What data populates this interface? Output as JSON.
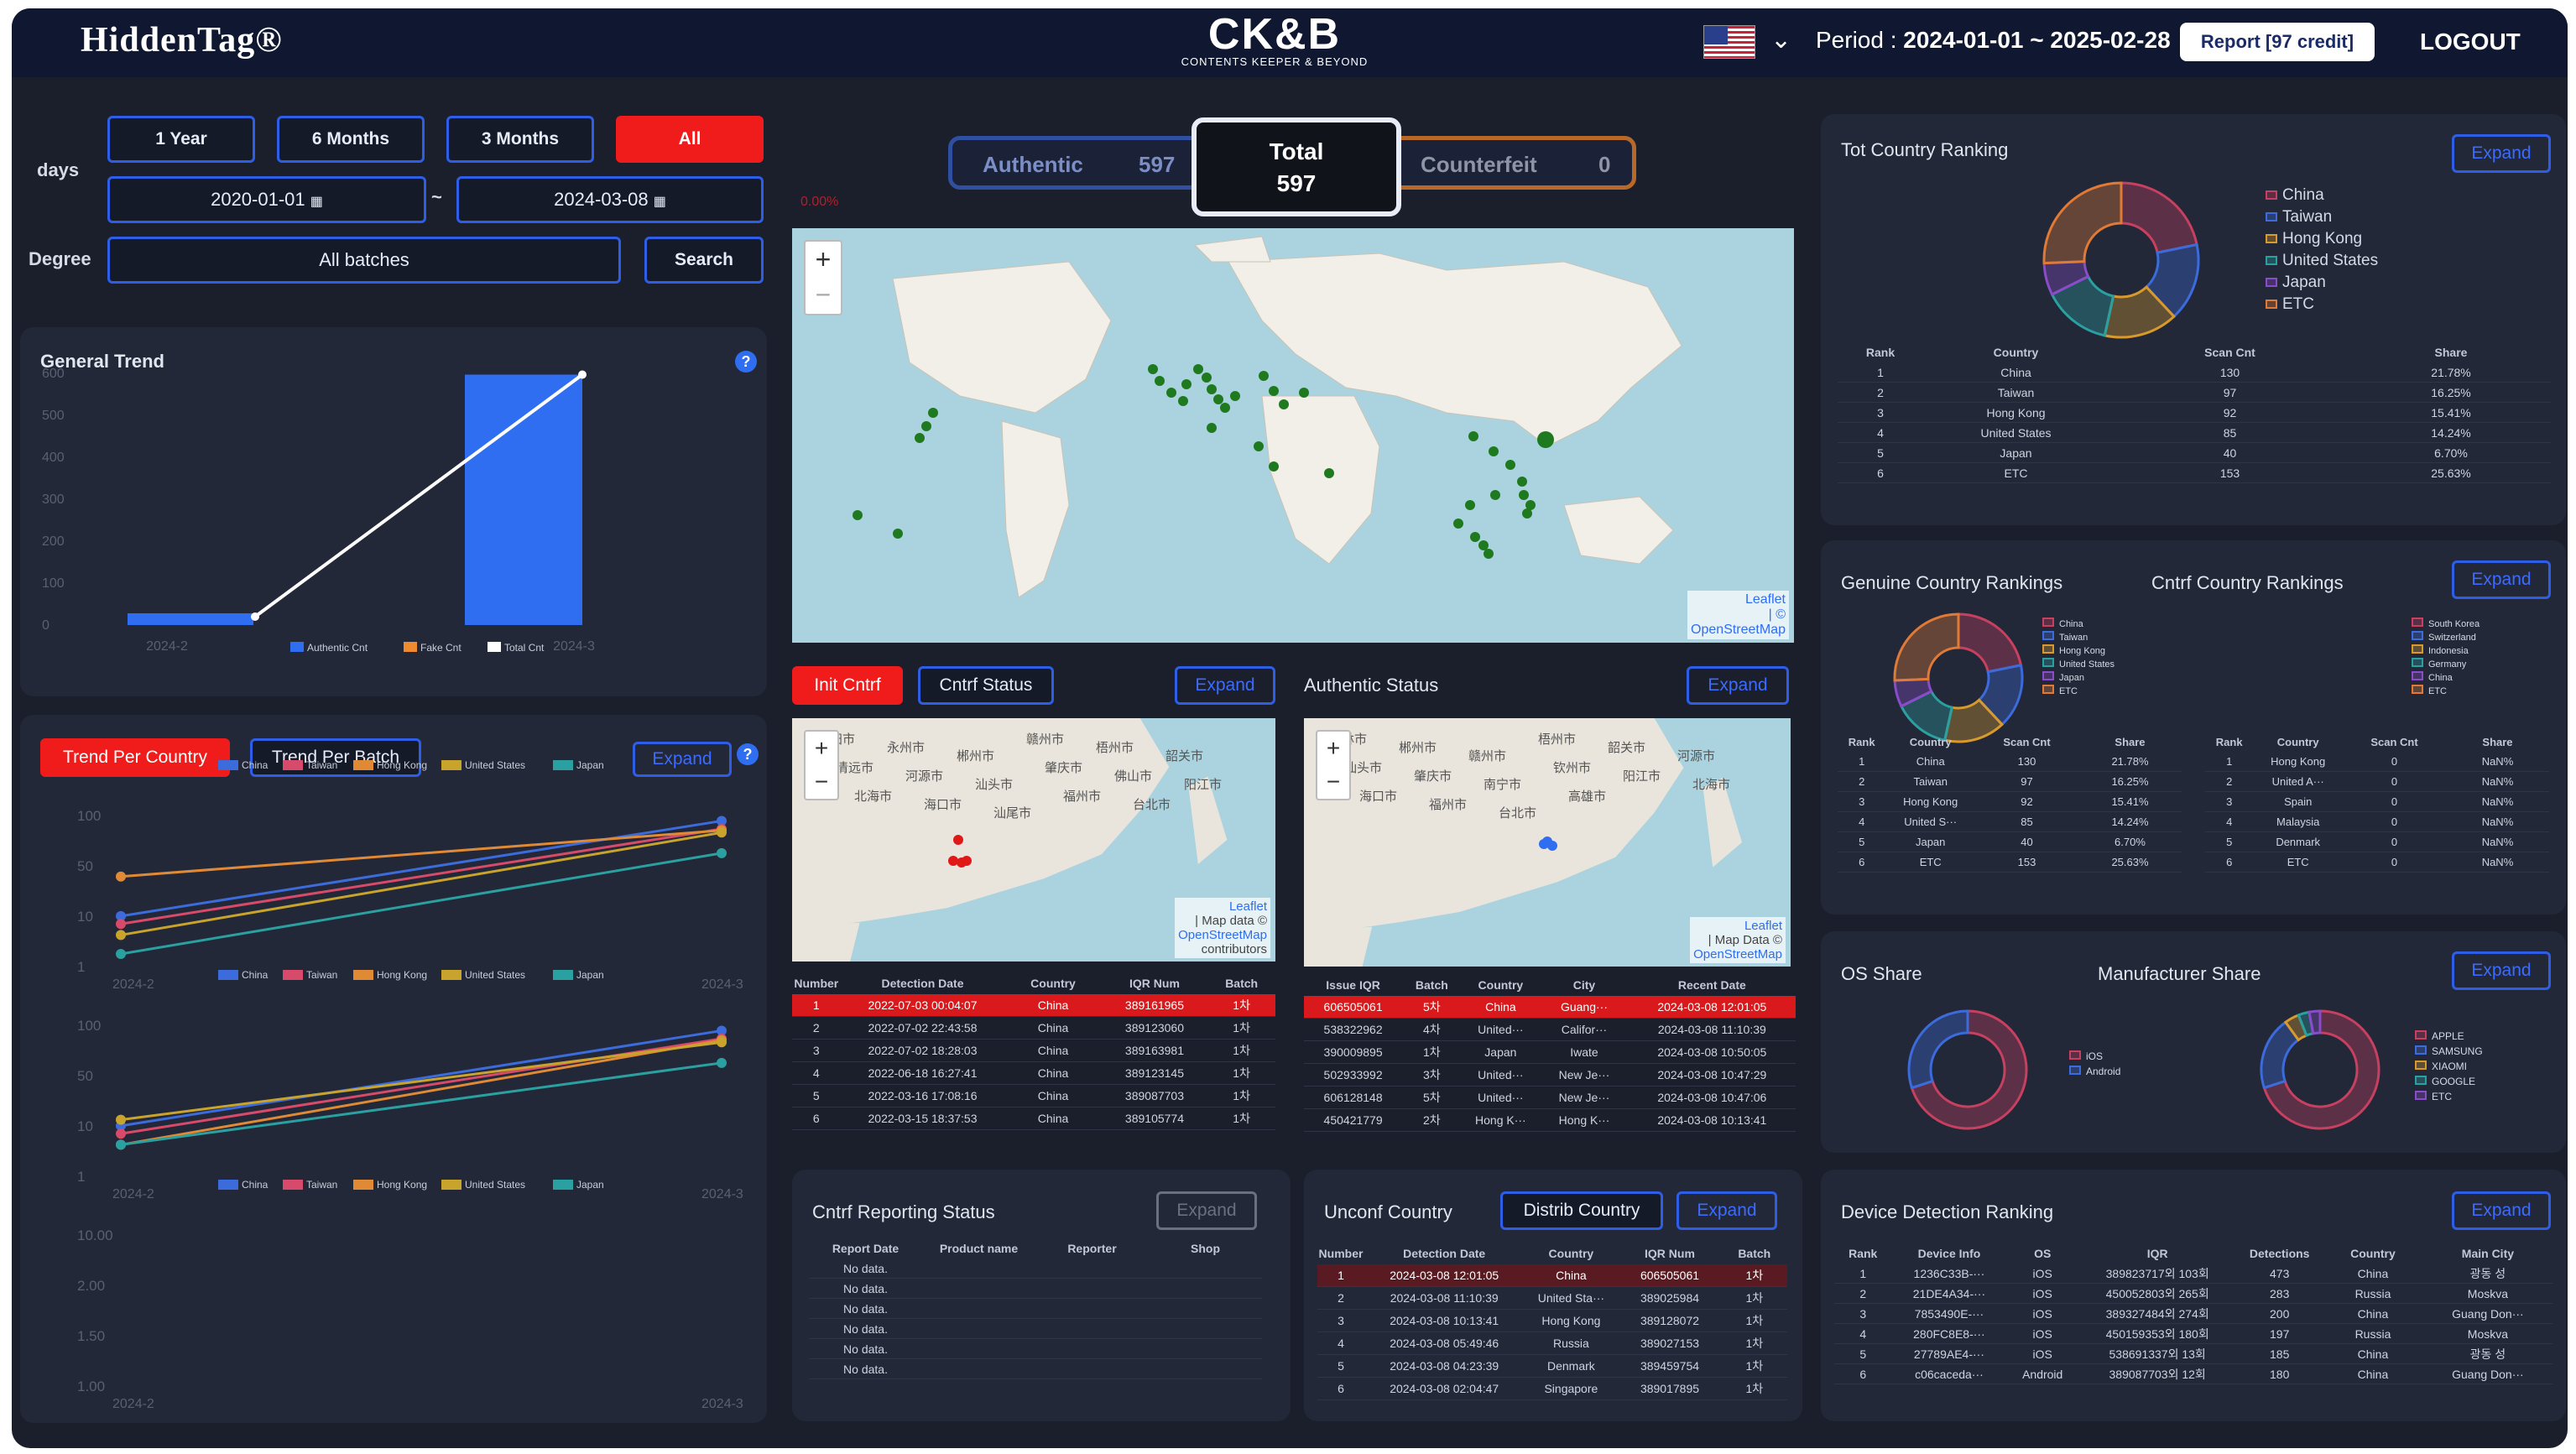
{
  "header": {
    "brand_left": "HiddenTag®",
    "brand_center": "CK&B",
    "brand_center_sub": "CONTENTS KEEPER & BEYOND",
    "period_label": "Period :",
    "period_value": "2024-01-01 ~ 2025-02-28",
    "report_button": "Report [97 credit]",
    "logout": "LOGOUT"
  },
  "filters": {
    "days_label": "days",
    "ranges": [
      "1 Year",
      "6 Months",
      "3 Months",
      "All"
    ],
    "active_range": "All",
    "date_from": "2020-01-01",
    "tilde": "~",
    "date_to": "2024-03-08",
    "degree_label": "Degree",
    "degree_value": "All batches",
    "search": "Search"
  },
  "general_trend": {
    "title": "General Trend",
    "help": "?",
    "chart_data": {
      "type": "bar",
      "categories": [
        "2024-2",
        "2024-3"
      ],
      "series": [
        {
          "name": "Authentic Cnt",
          "values": [
            20,
            597
          ],
          "color": "#2f6ef0"
        },
        {
          "name": "Fake Cnt",
          "values": [
            0,
            0
          ],
          "color": "#f08a2f"
        },
        {
          "name": "Total Cnt",
          "values": [
            20,
            597
          ],
          "color": "#ffffff"
        }
      ],
      "yticks": [
        "600",
        "500",
        "400",
        "300",
        "200",
        "100",
        "0"
      ],
      "ylim": [
        0,
        600
      ]
    }
  },
  "trend_country": {
    "tab_active": "Trend Per Country",
    "tab_other": "Trend Per Batch",
    "expand": "Expand",
    "help": "?",
    "legend": [
      {
        "name": "China",
        "color": "#3c6bdc"
      },
      {
        "name": "Taiwan",
        "color": "#d84a6a"
      },
      {
        "name": "Hong Kong",
        "color": "#e08a36"
      },
      {
        "name": "United States",
        "color": "#c9a42c"
      },
      {
        "name": "Japan",
        "color": "#2aa0a0"
      }
    ],
    "charts": [
      {
        "yticks": [
          "100",
          "50",
          "10",
          "1"
        ],
        "x": [
          "2024-2",
          "2024-3"
        ],
        "series": [
          {
            "name": "China",
            "values": [
              4,
              130
            ]
          },
          {
            "name": "Taiwan",
            "values": [
              3,
              97
            ]
          },
          {
            "name": "Hong Kong",
            "values": [
              17,
              92
            ]
          },
          {
            "name": "United States",
            "values": [
              2,
              85
            ]
          },
          {
            "name": "Japan",
            "values": [
              1,
              40
            ]
          }
        ]
      },
      {
        "yticks": [
          "100",
          "50",
          "10",
          "1"
        ],
        "x": [
          "2024-2",
          "2024-3"
        ],
        "series": [
          {
            "name": "China",
            "values": [
              4,
              130
            ]
          },
          {
            "name": "Taiwan",
            "values": [
              3,
              97
            ]
          },
          {
            "name": "Hong Kong",
            "values": [
              2,
              92
            ]
          },
          {
            "name": "United States",
            "values": [
              5,
              85
            ]
          },
          {
            "name": "Japan",
            "values": [
              2,
              40
            ]
          }
        ]
      },
      {
        "yticks": [
          "10.00",
          "2.00",
          "1.50",
          "1.00"
        ],
        "x": [
          "2024-2",
          "2024-3"
        ],
        "series": []
      }
    ]
  },
  "summary": {
    "authentic_label": "Authentic",
    "authentic_value": "597",
    "total_label": "Total",
    "total_value": "597",
    "counterfeit_label": "Counterfeit",
    "counterfeit_value": "0",
    "note": "0.00%"
  },
  "world_map": {
    "attribution_1": "Leaflet",
    "attribution_2": "| ©",
    "attribution_3": "OpenStreetMap"
  },
  "init_cntrf": {
    "tab_active": "Init Cntrf",
    "tab_other": "Cntrf Status",
    "expand": "Expand",
    "map_labels": [
      "衡阳市",
      "永州市",
      "郴州市",
      "赣州市",
      "梧州市",
      "韶关市",
      "清远市",
      "河源市",
      "汕头市",
      "肇庆市",
      "佛山市",
      "阳江市",
      "北海市",
      "海口市",
      "汕尾市",
      "福州市",
      "台北市"
    ],
    "map_attr": [
      "Leaflet",
      "| Map data ©",
      "OpenStreetMap",
      "contributors"
    ],
    "columns": [
      "Number",
      "Detection Date",
      "Country",
      "IQR Num",
      "Batch"
    ],
    "rows": [
      [
        "1",
        "2022-07-03 00:04:07",
        "China",
        "389161965",
        "1차"
      ],
      [
        "2",
        "2022-07-02 22:43:58",
        "China",
        "389123060",
        "1차"
      ],
      [
        "3",
        "2022-07-02 18:28:03",
        "China",
        "389163981",
        "1차"
      ],
      [
        "4",
        "2022-06-18 16:27:41",
        "China",
        "389123145",
        "1차"
      ],
      [
        "5",
        "2022-03-16 17:08:16",
        "China",
        "389087703",
        "1차"
      ],
      [
        "6",
        "2022-03-15 18:37:53",
        "China",
        "389105774",
        "1차"
      ]
    ]
  },
  "authentic_status": {
    "title": "Authentic Status",
    "expand": "Expand",
    "map_labels": [
      "桂林市",
      "郴州市",
      "赣州市",
      "梧州市",
      "韶关市",
      "河源市",
      "汕头市",
      "肇庆市",
      "南宁市",
      "钦州市",
      "阳江市",
      "北海市",
      "海口市",
      "福州市",
      "台北市",
      "高雄市"
    ],
    "map_attr": [
      "Leaflet",
      "| Map Data ©",
      "OpenStreetMap"
    ],
    "columns": [
      "Issue IQR",
      "Batch",
      "Country",
      "City",
      "Recent Date"
    ],
    "rows": [
      [
        "606505061",
        "5차",
        "China",
        "Guang···",
        "2024-03-08 12:01:05"
      ],
      [
        "538322962",
        "4차",
        "United···",
        "Califor···",
        "2024-03-08 11:10:39"
      ],
      [
        "390009895",
        "1차",
        "Japan",
        "Iwate",
        "2024-03-08 10:50:05"
      ],
      [
        "502933992",
        "3차",
        "United···",
        "New Je···",
        "2024-03-08 10:47:29"
      ],
      [
        "606128148",
        "5차",
        "United···",
        "New Je···",
        "2024-03-08 10:47:06"
      ],
      [
        "450421779",
        "2차",
        "Hong K···",
        "Hong K···",
        "2024-03-08 10:13:41"
      ]
    ]
  },
  "cntrf_reporting": {
    "title": "Cntrf Reporting Status",
    "expand": "Expand",
    "columns": [
      "Report Date",
      "Product name",
      "Reporter",
      "Shop"
    ],
    "rows": [
      "No data.",
      "No data.",
      "No data.",
      "No data.",
      "No data.",
      "No data."
    ]
  },
  "unconf_country": {
    "title": "Unconf Country",
    "tab_other": "Distrib Country",
    "expand": "Expand",
    "columns": [
      "Number",
      "Detection Date",
      "Country",
      "IQR Num",
      "Batch"
    ],
    "rows": [
      [
        "1",
        "2024-03-08 12:01:05",
        "China",
        "606505061",
        "1차"
      ],
      [
        "2",
        "2024-03-08 11:10:39",
        "United Sta···",
        "389025984",
        "1차"
      ],
      [
        "3",
        "2024-03-08 10:13:41",
        "Hong Kong",
        "389128072",
        "1차"
      ],
      [
        "4",
        "2024-03-08 05:49:46",
        "Russia",
        "389027153",
        "1차"
      ],
      [
        "5",
        "2024-03-08 04:23:39",
        "Denmark",
        "389459754",
        "1차"
      ],
      [
        "6",
        "2024-03-08 02:04:47",
        "Singapore",
        "389017895",
        "1차"
      ]
    ]
  },
  "tot_country": {
    "title": "Tot Country Ranking",
    "expand": "Expand",
    "legend": [
      {
        "name": "China",
        "color": "#c84060"
      },
      {
        "name": "Taiwan",
        "color": "#3c6bdc"
      },
      {
        "name": "Hong Kong",
        "color": "#d89a2c"
      },
      {
        "name": "United States",
        "color": "#2aa0a0"
      },
      {
        "name": "Japan",
        "color": "#8a4cc8"
      },
      {
        "name": "ETC",
        "color": "#e07a36"
      }
    ],
    "columns": [
      "Rank",
      "Country",
      "Scan Cnt",
      "Share"
    ],
    "rows": [
      [
        "1",
        "China",
        "130",
        "21.78%"
      ],
      [
        "2",
        "Taiwan",
        "97",
        "16.25%"
      ],
      [
        "3",
        "Hong Kong",
        "92",
        "15.41%"
      ],
      [
        "4",
        "United States",
        "85",
        "14.24%"
      ],
      [
        "5",
        "Japan",
        "40",
        "6.70%"
      ],
      [
        "6",
        "ETC",
        "153",
        "25.63%"
      ]
    ],
    "shares": [
      21.78,
      16.25,
      15.41,
      14.24,
      6.7,
      25.63
    ]
  },
  "genuine_country": {
    "title": "Genuine Country Rankings",
    "legend": [
      "China",
      "Taiwan",
      "Hong Kong",
      "United States",
      "Japan",
      "ETC"
    ],
    "columns": [
      "Rank",
      "Country",
      "Scan Cnt",
      "Share"
    ],
    "rows": [
      [
        "1",
        "China",
        "130",
        "21.78%"
      ],
      [
        "2",
        "Taiwan",
        "97",
        "16.25%"
      ],
      [
        "3",
        "Hong Kong",
        "92",
        "15.41%"
      ],
      [
        "4",
        "United S···",
        "85",
        "14.24%"
      ],
      [
        "5",
        "Japan",
        "40",
        "6.70%"
      ],
      [
        "6",
        "ETC",
        "153",
        "25.63%"
      ]
    ],
    "shares": [
      21.78,
      16.25,
      15.41,
      14.24,
      6.7,
      25.63
    ]
  },
  "cntrf_country": {
    "title": "Cntrf Country Rankings",
    "expand": "Expand",
    "legend": [
      "South Korea",
      "Switzerland",
      "Indonesia",
      "Germany",
      "China",
      "ETC"
    ],
    "columns": [
      "Rank",
      "Country",
      "Scan Cnt",
      "Share"
    ],
    "rows": [
      [
        "1",
        "Hong Kong",
        "0",
        "NaN%"
      ],
      [
        "2",
        "United A···",
        "0",
        "NaN%"
      ],
      [
        "3",
        "Spain",
        "0",
        "NaN%"
      ],
      [
        "4",
        "Malaysia",
        "0",
        "NaN%"
      ],
      [
        "5",
        "Denmark",
        "0",
        "NaN%"
      ],
      [
        "6",
        "ETC",
        "0",
        "NaN%"
      ]
    ]
  },
  "os_share": {
    "title": "OS Share",
    "legend": [
      {
        "name": "iOS",
        "color": "#c84060"
      },
      {
        "name": "Android",
        "color": "#3c6bdc"
      }
    ],
    "shares": [
      70,
      30
    ]
  },
  "manufacturer_share": {
    "title": "Manufacturer Share",
    "expand": "Expand",
    "legend": [
      {
        "name": "APPLE",
        "color": "#c84060"
      },
      {
        "name": "SAMSUNG",
        "color": "#3c6bdc"
      },
      {
        "name": "XIAOMI",
        "color": "#d89a2c"
      },
      {
        "name": "GOOGLE",
        "color": "#2aa0a0"
      },
      {
        "name": "ETC",
        "color": "#8a4cc8"
      }
    ],
    "shares": [
      70,
      20,
      4,
      3,
      3
    ]
  },
  "device_ranking": {
    "title": "Device Detection Ranking",
    "expand": "Expand",
    "columns": [
      "Rank",
      "Device Info",
      "OS",
      "IQR",
      "Detections",
      "Country",
      "Main City"
    ],
    "rows": [
      [
        "1",
        "1236C33B-···",
        "iOS",
        "389823717외 103회",
        "473",
        "China",
        "광동 성"
      ],
      [
        "2",
        "21DE4A34-···",
        "iOS",
        "450052803외 265회",
        "283",
        "Russia",
        "Moskva"
      ],
      [
        "3",
        "7853490E-···",
        "iOS",
        "389327484외 274회",
        "200",
        "China",
        "Guang Don···"
      ],
      [
        "4",
        "280FC8E8-···",
        "iOS",
        "450159353외 180회",
        "197",
        "Russia",
        "Moskva"
      ],
      [
        "5",
        "27789AE4-···",
        "iOS",
        "538691337외 13회",
        "185",
        "China",
        "광동 성"
      ],
      [
        "6",
        "c06caceda···",
        "Android",
        "389087703외 12회",
        "180",
        "China",
        "Guang Don···"
      ]
    ]
  }
}
